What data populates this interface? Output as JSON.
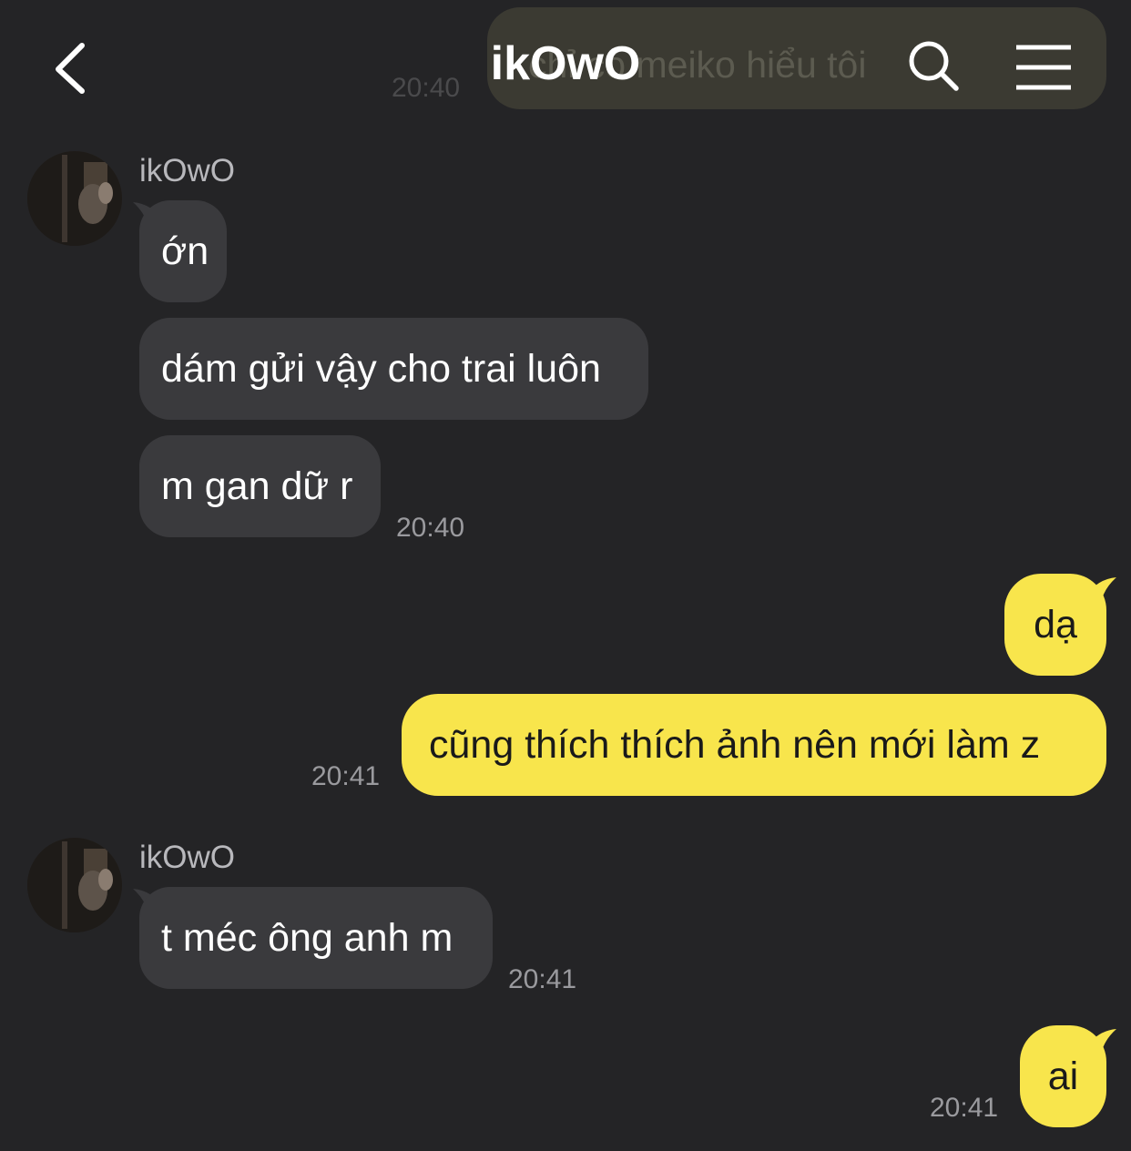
{
  "header": {
    "title": "ikOwO",
    "back_icon": "chevron-left-icon",
    "search_icon": "search-icon",
    "menu_icon": "hamburger-menu-icon"
  },
  "partial_top": {
    "text": "chỉ có meiko hiểu tôi",
    "time": "20:40"
  },
  "colors": {
    "background": "#242426",
    "incoming_bubble": "#3a3a3d",
    "outgoing_bubble": "#f8e54c",
    "timestamp": "#9a9a9e"
  },
  "messages": [
    {
      "sender": "ikOwO",
      "bubbles": [
        "ớn",
        "dám gửi vậy cho trai luôn",
        "m gan dữ r"
      ],
      "time": "20:40"
    },
    {
      "outgoing": true,
      "bubbles": [
        "dạ",
        "cũng thích thích ảnh nên mới làm z"
      ],
      "time": "20:41"
    },
    {
      "sender": "ikOwO",
      "bubbles": [
        "t méc ông anh m"
      ],
      "time": "20:41"
    },
    {
      "outgoing": true,
      "bubbles": [
        "ai"
      ],
      "time": "20:41"
    }
  ]
}
